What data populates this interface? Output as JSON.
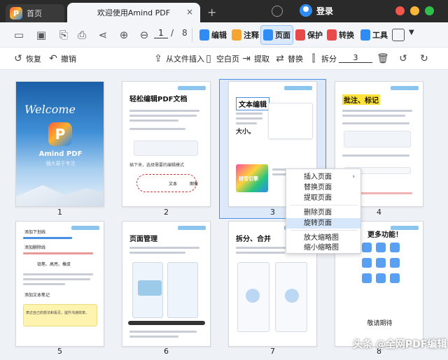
{
  "titlebar": {
    "home_tab": "首页",
    "doc_tab": "欢迎使用Amind PDF",
    "close_glyph": "×",
    "new_tab_glyph": "+",
    "login": "登录",
    "window_dots": [
      "#f2564d",
      "#f6b73c",
      "#2fbf4b"
    ]
  },
  "toolbar": {
    "page_current": "1",
    "page_separator": "/",
    "page_total": "8",
    "modes": [
      {
        "label": "编辑",
        "color": "#2f8cf5"
      },
      {
        "label": "注释",
        "color": "#f6a531"
      },
      {
        "label": "页面",
        "color": "#2f8cf5"
      },
      {
        "label": "保护",
        "color": "#e84a4a"
      },
      {
        "label": "转换",
        "color": "#e84a4a"
      },
      {
        "label": "工具",
        "color": "#2f8cf5"
      }
    ],
    "active_mode": "页面"
  },
  "pagebar": {
    "restore": "恢复",
    "undo": "撤销",
    "insert_from_file": "从文件插入",
    "blank_page": "空白页",
    "extract": "提取",
    "replace": "替换",
    "split": "拆分",
    "rotate_value": "3"
  },
  "thumbnails": [
    {
      "num": "1"
    },
    {
      "num": "2"
    },
    {
      "num": "3"
    },
    {
      "num": "4"
    },
    {
      "num": "5"
    },
    {
      "num": "6"
    },
    {
      "num": "7"
    },
    {
      "num": "8"
    }
  ],
  "pages": {
    "p1": {
      "welcome": "Welcome",
      "logo_letter": "P",
      "name": "Amind PDF",
      "sub": "强大易于专注"
    },
    "p2": {
      "title": "轻松编辑PDF文档",
      "steps": [
        "插下来，选择需要的编辑模式"
      ],
      "labels": [
        "文本",
        "图像"
      ]
    },
    "p3": {
      "title": "文本编辑",
      "big": "大小。",
      "banner": "拼写引擎"
    },
    "p4": {
      "title": "批注、标记"
    },
    "p5": {
      "lines": [
        "添加下划线",
        "添加删除线",
        "铅笔、高亮、橡皮",
        "添加文本笔记"
      ],
      "note": "表达自己的想法和看见，提升沟通效率。"
    },
    "p6": {
      "title": "页面管理"
    },
    "p7": {
      "title": "拆分、合并"
    },
    "p8": {
      "title": "更多功能！",
      "footer": "敬请期待"
    }
  },
  "context_menu": {
    "items": [
      "插入页面",
      "替换页面",
      "提取页面",
      "删除页面",
      "旋转页面",
      "放大缩略图",
      "缩小缩略图"
    ],
    "highlighted": "旋转页面",
    "submenu_arrow": "›"
  },
  "watermark": "头条 @全网PDF编辑"
}
